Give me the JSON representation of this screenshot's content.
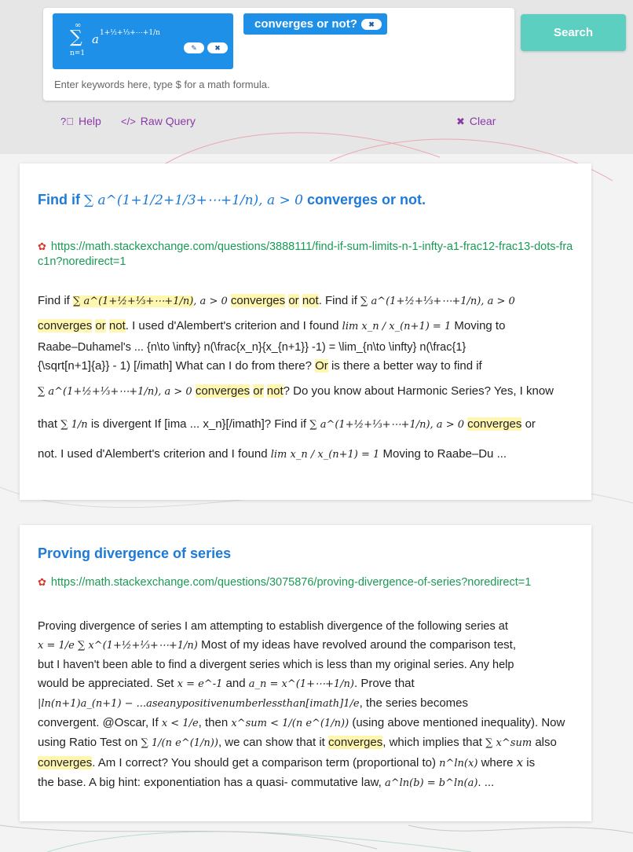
{
  "search": {
    "math_chip_formula": "∑∞n=1 a^(1+1/2+1/3+⋯+1/n)",
    "math_chip_sum_top": "∞",
    "math_chip_sum_bottom": "n=1",
    "math_chip_base": "a",
    "math_chip_exponent": "1+½+⅓+⋯+1/n",
    "edit_icon": "✎",
    "remove_icon": "✖",
    "text_chip": "converges or not?",
    "placeholder": "Enter keywords here, type $ for a math formula.",
    "button_label": "Search"
  },
  "toolbar": {
    "help_label": "Help",
    "raw_query_label": "Raw Query",
    "clear_label": "Clear"
  },
  "results": [
    {
      "title_prefix": "Find if",
      "title_math": "∑ a^(1+1/2+1/3+⋯+1/n), a > 0",
      "title_suffix": "converges or not.",
      "url": "https://math.stackexchange.com/questions/3888111/find-if-sum-limits-n-1-infty-a1-frac12-frac13-dots-frac1n?noredirect=1",
      "snippet": {
        "l1_a": "Find if",
        "l1_m1": "∑ a^(1+½+⅓+⋯+1/n)",
        "l1_m2": ", a > 0",
        "hl_converges": "converges",
        "hl_or": "or",
        "hl_not": "not",
        "l1_b": ". Find if",
        "l1_m3": "∑ a^(1+½+⅓+⋯+1/n), a > 0",
        "l2_b": ". I used d'Alembert's criterion and I found",
        "l2_m": "lim x_n / x_(n+1) = 1",
        "l2_c": "Moving to",
        "l3": "Raabe–Duhamel's ... {n\\to \\infty} n(\\frac{x_n}{x_{n+1}} -1) = \\lim_{n\\to \\infty} n(\\frac{1}",
        "l4_a": "{\\sqrt[n+1]{a}} - 1) [/imath] What can I do from there?",
        "hl_or2": "Or",
        "l4_b": "is there a better way to find if",
        "l5_m": "∑ a^(1+½+⅓+⋯+1/n), a > 0",
        "l5_b": "? Do you know about Harmonic Series? Yes, I know",
        "l6_a": "that",
        "l6_m": "∑ 1/n",
        "l6_b": "is divergent If [ima ... x_n}[/imath]? Find if",
        "l6_m2": "∑ a^(1+½+⅓+⋯+1/n), a > 0",
        "l6_c": "or",
        "l7_a": "not. I used d'Alembert's criterion and I found",
        "l7_m": "lim x_n / x_(n+1) = 1",
        "l7_b": "Moving to Raabe–Du ..."
      }
    },
    {
      "title": "Proving divergence of series",
      "url": "https://math.stackexchange.com/questions/3075876/proving-divergence-of-series?noredirect=1",
      "snippet": {
        "l1": "Proving divergence of series I am attempting to establish divergence of the following series at",
        "l2_m": "x = 1/e ∑ x^(1+½+⅓+⋯+1/n)",
        "l2_b": "Most of my ideas have revolved around the comparison test,",
        "l3": "but I haven't been able to find a divergent series which is less than my original series. Any help",
        "l4_a": "would be appreciated. Set",
        "l4_m1": "x = e^-1",
        "l4_b": "and",
        "l4_m2": "a_n = x^(1+⋯+1/n)",
        "l4_c": ". Prove that",
        "l5_m": "|ln(n+1)a_(n+1) − ...aseanypositivenumberlessthan[imath]1/e",
        "l5_b": ", the series becomes",
        "l6_a": "convergent. @Oscar, If",
        "l6_m1": "x < 1/e",
        "l6_b": ", then",
        "l6_m2": "x^sum < 1/(n e^(1/n))",
        "l6_c": "(using above mentioned inequality). Now",
        "l7_a": "using Ratio Test on",
        "l7_m": "∑ 1/(n e^(1/n))",
        "l7_b": ", we can show that it",
        "hl_converges": "converges",
        "l7_c": ", which implies that",
        "l7_m2": "∑ x^sum",
        "l7_d": "also",
        "l8_b": ". Am I correct? You should get a comparison term (proportional to)",
        "l8_m": "n^ln(x)",
        "l8_c": "where",
        "l8_m2": "x",
        "l8_d": "is",
        "l9_a": "the base. A big hint: exponentiation has a quasi- commutative law,",
        "l9_m": "a^ln(b) = b^ln(a)",
        "l9_b": ". ..."
      }
    }
  ]
}
